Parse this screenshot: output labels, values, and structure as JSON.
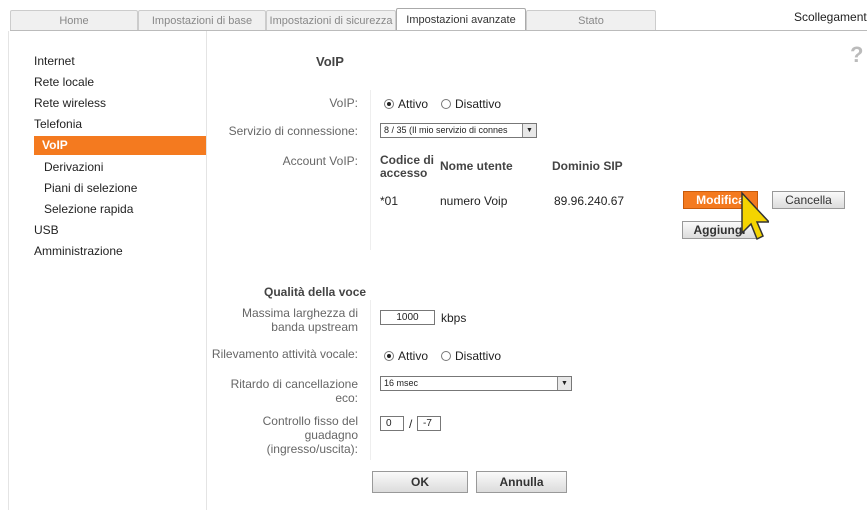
{
  "tabs": [
    {
      "label": "Home"
    },
    {
      "label": "Impostazioni di base"
    },
    {
      "label": "Impostazioni di sicurezza"
    },
    {
      "label": "Impostazioni avanzate"
    },
    {
      "label": "Stato"
    }
  ],
  "logout_label": "Scollegamento",
  "nav": {
    "items": [
      {
        "label": "Internet"
      },
      {
        "label": "Rete locale"
      },
      {
        "label": "Rete wireless"
      },
      {
        "label": "Telefonia"
      },
      {
        "label": "VoIP"
      },
      {
        "label": "Derivazioni"
      },
      {
        "label": "Piani di selezione"
      },
      {
        "label": "Selezione rapida"
      },
      {
        "label": "USB"
      },
      {
        "label": "Amministrazione"
      }
    ]
  },
  "page_title": "VoIP",
  "help_glyph": "?",
  "voip": {
    "label": "VoIP:",
    "option_on": "Attivo",
    "option_off": "Disattivo"
  },
  "service": {
    "label": "Servizio di connessione:",
    "value": "8 / 35 (Il mio servizio di connes"
  },
  "accounts": {
    "label": "Account VoIP:",
    "col_code": "Codice di accesso",
    "col_code_l1": "Codice di",
    "col_code_l2": "accesso",
    "col_user": "Nome utente",
    "col_domain": "Dominio SIP",
    "rows": [
      {
        "code": "*01",
        "user": "numero Voip",
        "domain": "89.96.240.67"
      }
    ],
    "edit_label": "Modifica",
    "delete_label": "Cancella",
    "add_label": "Aggiungi"
  },
  "quality": {
    "title": "Qualità della voce",
    "bandwidth_label_l1": "Massima larghezza di",
    "bandwidth_label_l2": "banda upstream",
    "bandwidth_value": "1000",
    "bandwidth_unit": "kbps",
    "vad_label": "Rilevamento attività vocale:",
    "vad_on": "Attivo",
    "vad_off": "Disattivo",
    "echo_label_l1": "Ritardo di cancellazione",
    "echo_label_l2": "eco:",
    "echo_value": "16 msec",
    "gain_label_l1": "Controllo fisso del",
    "gain_label_l2": "guadagno",
    "gain_label_l3": "(ingresso/uscita):",
    "gain_in": "0",
    "gain_sep": "/",
    "gain_out": "-7"
  },
  "buttons": {
    "ok": "OK",
    "cancel": "Annulla"
  }
}
